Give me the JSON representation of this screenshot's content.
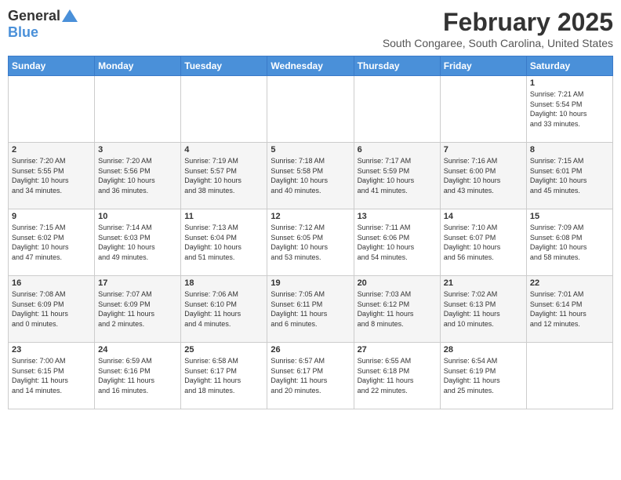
{
  "header": {
    "logo": {
      "general": "General",
      "blue": "Blue"
    },
    "title": "February 2025",
    "location": "South Congaree, South Carolina, United States"
  },
  "weekdays": [
    "Sunday",
    "Monday",
    "Tuesday",
    "Wednesday",
    "Thursday",
    "Friday",
    "Saturday"
  ],
  "weeks": [
    [
      {
        "day": "",
        "info": ""
      },
      {
        "day": "",
        "info": ""
      },
      {
        "day": "",
        "info": ""
      },
      {
        "day": "",
        "info": ""
      },
      {
        "day": "",
        "info": ""
      },
      {
        "day": "",
        "info": ""
      },
      {
        "day": "1",
        "info": "Sunrise: 7:21 AM\nSunset: 5:54 PM\nDaylight: 10 hours\nand 33 minutes."
      }
    ],
    [
      {
        "day": "2",
        "info": "Sunrise: 7:20 AM\nSunset: 5:55 PM\nDaylight: 10 hours\nand 34 minutes."
      },
      {
        "day": "3",
        "info": "Sunrise: 7:20 AM\nSunset: 5:56 PM\nDaylight: 10 hours\nand 36 minutes."
      },
      {
        "day": "4",
        "info": "Sunrise: 7:19 AM\nSunset: 5:57 PM\nDaylight: 10 hours\nand 38 minutes."
      },
      {
        "day": "5",
        "info": "Sunrise: 7:18 AM\nSunset: 5:58 PM\nDaylight: 10 hours\nand 40 minutes."
      },
      {
        "day": "6",
        "info": "Sunrise: 7:17 AM\nSunset: 5:59 PM\nDaylight: 10 hours\nand 41 minutes."
      },
      {
        "day": "7",
        "info": "Sunrise: 7:16 AM\nSunset: 6:00 PM\nDaylight: 10 hours\nand 43 minutes."
      },
      {
        "day": "8",
        "info": "Sunrise: 7:15 AM\nSunset: 6:01 PM\nDaylight: 10 hours\nand 45 minutes."
      }
    ],
    [
      {
        "day": "9",
        "info": "Sunrise: 7:15 AM\nSunset: 6:02 PM\nDaylight: 10 hours\nand 47 minutes."
      },
      {
        "day": "10",
        "info": "Sunrise: 7:14 AM\nSunset: 6:03 PM\nDaylight: 10 hours\nand 49 minutes."
      },
      {
        "day": "11",
        "info": "Sunrise: 7:13 AM\nSunset: 6:04 PM\nDaylight: 10 hours\nand 51 minutes."
      },
      {
        "day": "12",
        "info": "Sunrise: 7:12 AM\nSunset: 6:05 PM\nDaylight: 10 hours\nand 53 minutes."
      },
      {
        "day": "13",
        "info": "Sunrise: 7:11 AM\nSunset: 6:06 PM\nDaylight: 10 hours\nand 54 minutes."
      },
      {
        "day": "14",
        "info": "Sunrise: 7:10 AM\nSunset: 6:07 PM\nDaylight: 10 hours\nand 56 minutes."
      },
      {
        "day": "15",
        "info": "Sunrise: 7:09 AM\nSunset: 6:08 PM\nDaylight: 10 hours\nand 58 minutes."
      }
    ],
    [
      {
        "day": "16",
        "info": "Sunrise: 7:08 AM\nSunset: 6:09 PM\nDaylight: 11 hours\nand 0 minutes."
      },
      {
        "day": "17",
        "info": "Sunrise: 7:07 AM\nSunset: 6:09 PM\nDaylight: 11 hours\nand 2 minutes."
      },
      {
        "day": "18",
        "info": "Sunrise: 7:06 AM\nSunset: 6:10 PM\nDaylight: 11 hours\nand 4 minutes."
      },
      {
        "day": "19",
        "info": "Sunrise: 7:05 AM\nSunset: 6:11 PM\nDaylight: 11 hours\nand 6 minutes."
      },
      {
        "day": "20",
        "info": "Sunrise: 7:03 AM\nSunset: 6:12 PM\nDaylight: 11 hours\nand 8 minutes."
      },
      {
        "day": "21",
        "info": "Sunrise: 7:02 AM\nSunset: 6:13 PM\nDaylight: 11 hours\nand 10 minutes."
      },
      {
        "day": "22",
        "info": "Sunrise: 7:01 AM\nSunset: 6:14 PM\nDaylight: 11 hours\nand 12 minutes."
      }
    ],
    [
      {
        "day": "23",
        "info": "Sunrise: 7:00 AM\nSunset: 6:15 PM\nDaylight: 11 hours\nand 14 minutes."
      },
      {
        "day": "24",
        "info": "Sunrise: 6:59 AM\nSunset: 6:16 PM\nDaylight: 11 hours\nand 16 minutes."
      },
      {
        "day": "25",
        "info": "Sunrise: 6:58 AM\nSunset: 6:17 PM\nDaylight: 11 hours\nand 18 minutes."
      },
      {
        "day": "26",
        "info": "Sunrise: 6:57 AM\nSunset: 6:17 PM\nDaylight: 11 hours\nand 20 minutes."
      },
      {
        "day": "27",
        "info": "Sunrise: 6:55 AM\nSunset: 6:18 PM\nDaylight: 11 hours\nand 22 minutes."
      },
      {
        "day": "28",
        "info": "Sunrise: 6:54 AM\nSunset: 6:19 PM\nDaylight: 11 hours\nand 25 minutes."
      },
      {
        "day": "",
        "info": ""
      }
    ]
  ]
}
